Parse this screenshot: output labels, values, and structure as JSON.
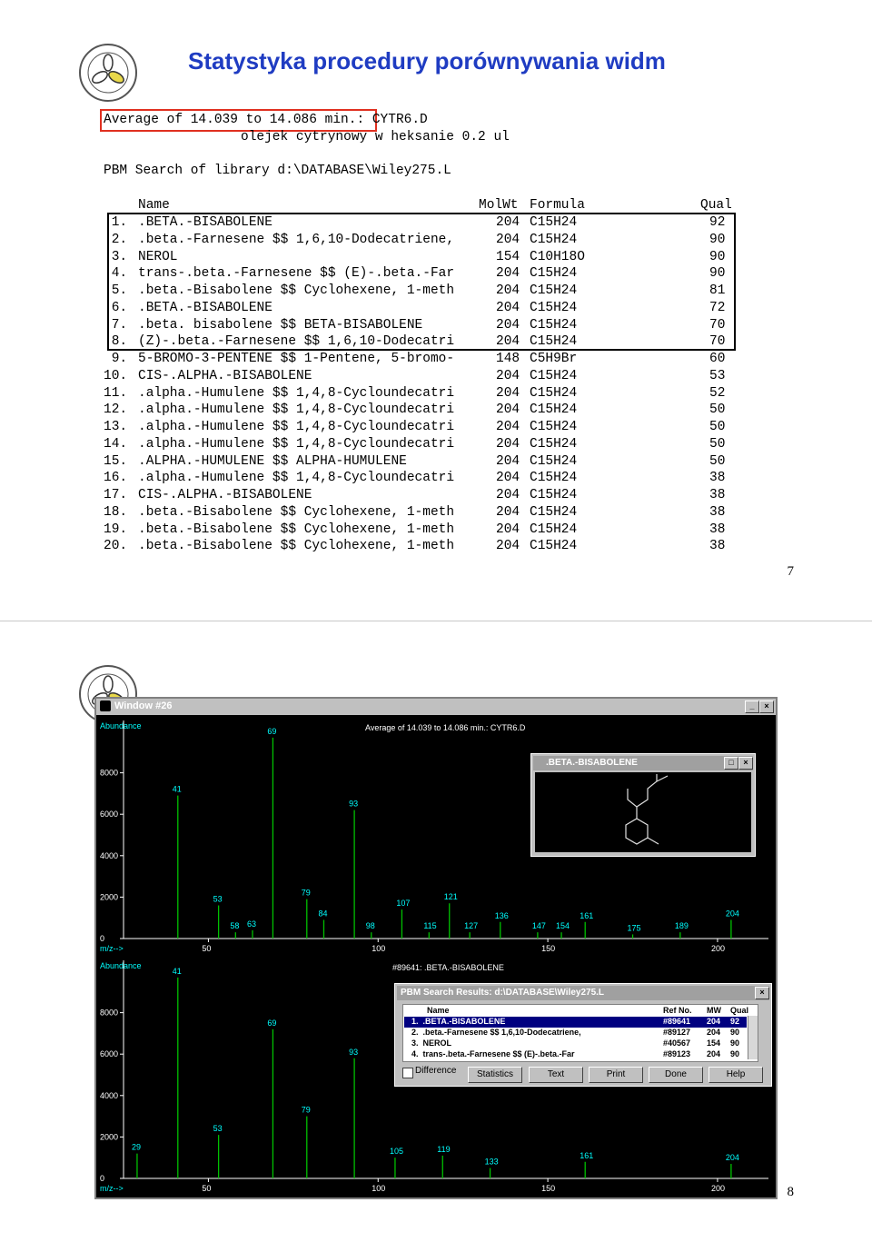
{
  "slide1": {
    "title": "Statystyka procedury porównywania widm",
    "average_line": "Average of 14.039 to 14.086 min.: CYTR6.D",
    "sample_line": "olejek cytrynowy w heksanie 0.2 ul",
    "search_line": "PBM Search of library d:\\DATABASE\\Wiley275.L",
    "headers": {
      "name": "Name",
      "molwt": "MolWt",
      "formula": "Formula",
      "qual": "Qual"
    },
    "hits": [
      {
        "n": " 1.",
        "name": ".BETA.-BISABOLENE",
        "mw": "204",
        "f": "C15H24",
        "q": "92"
      },
      {
        "n": " 2.",
        "name": ".beta.-Farnesene $$ 1,6,10-Dodecatriene,",
        "mw": "204",
        "f": "C15H24",
        "q": "90"
      },
      {
        "n": " 3.",
        "name": "NEROL",
        "mw": "154",
        "f": "C10H18O",
        "q": "90"
      },
      {
        "n": " 4.",
        "name": "trans-.beta.-Farnesene $$ (E)-.beta.-Far",
        "mw": "204",
        "f": "C15H24",
        "q": "90"
      },
      {
        "n": " 5.",
        "name": ".beta.-Bisabolene $$ Cyclohexene, 1-meth",
        "mw": "204",
        "f": "C15H24",
        "q": "81"
      },
      {
        "n": " 6.",
        "name": ".BETA.-BISABOLENE",
        "mw": "204",
        "f": "C15H24",
        "q": "72"
      },
      {
        "n": " 7.",
        "name": ".beta. bisabolene $$ BETA-BISABOLENE",
        "mw": "204",
        "f": "C15H24",
        "q": "70"
      },
      {
        "n": " 8.",
        "name": "(Z)-.beta.-Farnesene $$ 1,6,10-Dodecatri",
        "mw": "204",
        "f": "C15H24",
        "q": "70"
      },
      {
        "n": " 9.",
        "name": "5-BROMO-3-PENTENE $$ 1-Pentene, 5-bromo-",
        "mw": "148",
        "f": "C5H9Br",
        "q": "60"
      },
      {
        "n": "10.",
        "name": "CIS-.ALPHA.-BISABOLENE",
        "mw": "204",
        "f": "C15H24",
        "q": "53"
      },
      {
        "n": "11.",
        "name": ".alpha.-Humulene $$ 1,4,8-Cycloundecatri",
        "mw": "204",
        "f": "C15H24",
        "q": "52"
      },
      {
        "n": "12.",
        "name": ".alpha.-Humulene $$ 1,4,8-Cycloundecatri",
        "mw": "204",
        "f": "C15H24",
        "q": "50"
      },
      {
        "n": "13.",
        "name": ".alpha.-Humulene $$ 1,4,8-Cycloundecatri",
        "mw": "204",
        "f": "C15H24",
        "q": "50"
      },
      {
        "n": "14.",
        "name": ".alpha.-Humulene $$ 1,4,8-Cycloundecatri",
        "mw": "204",
        "f": "C15H24",
        "q": "50"
      },
      {
        "n": "15.",
        "name": ".ALPHA.-HUMULENE $$ ALPHA-HUMULENE",
        "mw": "204",
        "f": "C15H24",
        "q": "50"
      },
      {
        "n": "16.",
        "name": ".alpha.-Humulene $$ 1,4,8-Cycloundecatri",
        "mw": "204",
        "f": "C15H24",
        "q": "38"
      },
      {
        "n": "17.",
        "name": "CIS-.ALPHA.-BISABOLENE",
        "mw": "204",
        "f": "C15H24",
        "q": "38"
      },
      {
        "n": "18.",
        "name": ".beta.-Bisabolene $$ Cyclohexene, 1-meth",
        "mw": "204",
        "f": "C15H24",
        "q": "38"
      },
      {
        "n": "19.",
        "name": ".beta.-Bisabolene $$ Cyclohexene, 1-meth",
        "mw": "204",
        "f": "C15H24",
        "q": "38"
      },
      {
        "n": "20.",
        "name": ".beta.-Bisabolene $$ Cyclohexene, 1-meth",
        "mw": "204",
        "f": "C15H24",
        "q": "38"
      }
    ],
    "page_number": "7"
  },
  "slide2": {
    "window_title": "Window #26",
    "page_number": "8",
    "top_spectrum": {
      "ylabel": "Abundance",
      "xlabel": "m/z-->",
      "header": "Average of 14.039 to 14.086 min.: CYTR6.D",
      "yticks": [
        "0",
        "2000",
        "4000",
        "6000",
        "8000"
      ],
      "xticks": [
        "50",
        "100",
        "150",
        "200"
      ],
      "peak_labels": [
        "41",
        "53",
        "58",
        "63",
        "69",
        "79",
        "84",
        "93",
        "98",
        "107",
        "115",
        "121",
        "127",
        "136",
        "147",
        "154",
        "161",
        "175",
        "189",
        "204"
      ]
    },
    "bottom_spectrum": {
      "ylabel": "Abundance",
      "xlabel": "m/z-->",
      "header": "#89641: .BETA.-BISABOLENE",
      "yticks": [
        "0",
        "2000",
        "4000",
        "6000",
        "8000"
      ],
      "xticks": [
        "50",
        "100",
        "150",
        "200"
      ],
      "peak_labels": [
        "29",
        "41",
        "53",
        "69",
        "79",
        "93",
        "105",
        "119",
        "133",
        "161",
        "204"
      ]
    },
    "structure_window": {
      "title": ".BETA.-BISABOLENE"
    },
    "pbm_dialog": {
      "title": "PBM Search Results: d:\\DATABASE\\Wiley275.L",
      "headers": {
        "name": "Name",
        "ref": "Ref No.",
        "mw": "MW",
        "qual": "Qual"
      },
      "rows": [
        {
          "name": "1.  .BETA.-BISABOLENE",
          "ref": "#89641",
          "mw": "204",
          "qual": "92"
        },
        {
          "name": "2.  .beta.-Farnesene $$ 1,6,10-Dodecatriene,",
          "ref": "#89127",
          "mw": "204",
          "qual": "90"
        },
        {
          "name": "3.  NEROL",
          "ref": "#40567",
          "mw": "154",
          "qual": "90"
        },
        {
          "name": "4.  trans-.beta.-Farnesene $$ (E)-.beta.-Far",
          "ref": "#89123",
          "mw": "204",
          "qual": "90"
        }
      ],
      "checkbox_label": "Difference",
      "buttons": [
        "Statistics",
        "Text",
        "Print",
        "Done",
        "Help"
      ]
    }
  },
  "colors": {
    "title_blue": "#1f3cc2",
    "highlight_red": "#e03020",
    "spectrum_green": "#00c000",
    "selection_blue": "#000080"
  },
  "chart_data": [
    {
      "type": "bar",
      "title": "Average of 14.039 to 14.086 min.: CYTR6.D",
      "xlabel": "m/z-->",
      "ylabel": "Abundance",
      "xlim": [
        25,
        215
      ],
      "ylim": [
        0,
        10000
      ],
      "x": [
        41,
        53,
        58,
        63,
        69,
        79,
        84,
        93,
        98,
        107,
        115,
        121,
        127,
        136,
        147,
        154,
        161,
        175,
        189,
        204
      ],
      "values": [
        6900,
        1600,
        300,
        400,
        9700,
        1900,
        900,
        6200,
        300,
        1400,
        300,
        1700,
        300,
        800,
        300,
        300,
        800,
        200,
        300,
        900
      ]
    },
    {
      "type": "bar",
      "title": "#89641: .BETA.-BISABOLENE",
      "xlabel": "m/z-->",
      "ylabel": "Abundance",
      "xlim": [
        25,
        215
      ],
      "ylim": [
        0,
        10000
      ],
      "x": [
        29,
        41,
        53,
        69,
        79,
        93,
        105,
        119,
        133,
        161,
        204
      ],
      "values": [
        1200,
        9700,
        2100,
        7200,
        3000,
        5800,
        1000,
        1100,
        500,
        800,
        700
      ]
    }
  ]
}
